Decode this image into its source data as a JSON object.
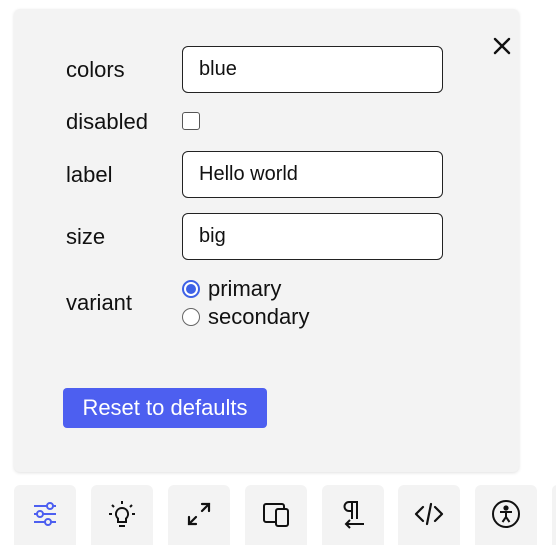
{
  "controls": {
    "colors": {
      "label": "colors",
      "value": "blue"
    },
    "disabled": {
      "label": "disabled",
      "checked": false
    },
    "label": {
      "label": "label",
      "value": "Hello world"
    },
    "size": {
      "label": "size",
      "value": "big"
    },
    "variant": {
      "label": "variant",
      "options": [
        "primary",
        "secondary"
      ],
      "selected": "primary"
    }
  },
  "reset_label": "Reset to defaults",
  "colors_theme": {
    "accent": "#3e61e6",
    "button": "#4d5ff0",
    "panel": "#f3f3f3"
  },
  "toolbar": {
    "icons": [
      "sliders-icon",
      "lightbulb-icon",
      "expand-icon",
      "devices-icon",
      "text-direction-icon",
      "code-icon",
      "accessibility-icon"
    ]
  }
}
